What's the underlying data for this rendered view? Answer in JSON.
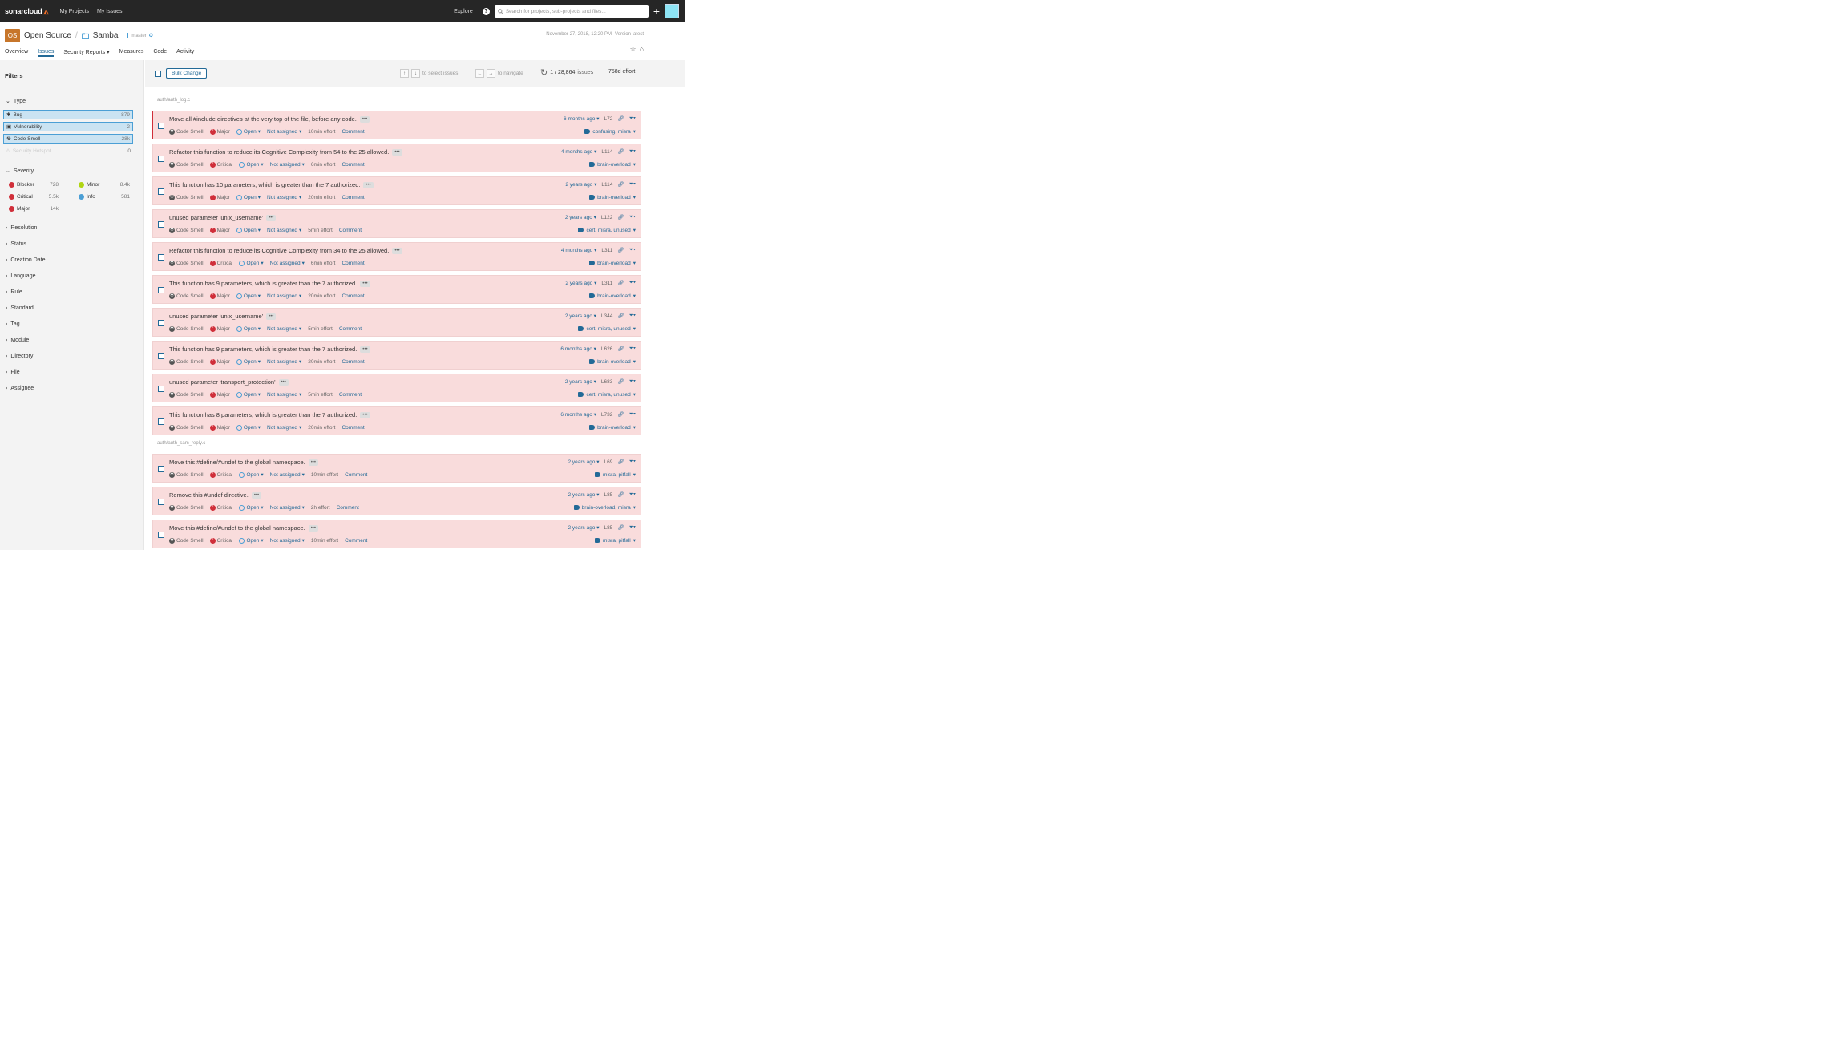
{
  "topbar": {
    "logo_text": "sonarcloud",
    "nav": [
      "My Projects",
      "My Issues"
    ],
    "explore": "Explore",
    "help": "?",
    "search_placeholder": "Search for projects, sub-projects and files...",
    "plus": "+"
  },
  "project": {
    "org_badge": "OS",
    "org": "Open Source",
    "separator": "/",
    "name": "Samba",
    "branch": "master",
    "date": "November 27, 2018, 12:20 PM",
    "version": "Version latest",
    "tabs": [
      "Overview",
      "Issues",
      "Security Reports ▾",
      "Measures",
      "Code",
      "Activity"
    ],
    "active_tab": "Issues"
  },
  "sidebar": {
    "filters_title": "Filters",
    "type_label": "Type",
    "types": [
      {
        "label": "Bug",
        "count": "879"
      },
      {
        "label": "Vulnerability",
        "count": "2"
      },
      {
        "label": "Code Smell",
        "count": "28k"
      },
      {
        "label": "Security Hotspot",
        "count": "0"
      }
    ],
    "severity_label": "Severity",
    "severities": [
      {
        "label": "Blocker",
        "count": "728"
      },
      {
        "label": "Minor",
        "count": "8.4k"
      },
      {
        "label": "Critical",
        "count": "5.5k"
      },
      {
        "label": "Info",
        "count": "581"
      },
      {
        "label": "Major",
        "count": "14k"
      }
    ],
    "facets": [
      "Resolution",
      "Status",
      "Creation Date",
      "Language",
      "Rule",
      "Standard",
      "Tag",
      "Module",
      "Directory",
      "File",
      "Assignee"
    ]
  },
  "toolbar": {
    "bulk_change": "Bulk Change",
    "up": "↑",
    "down": "↓",
    "select_hint": "to select issues",
    "left": "←",
    "right": "→",
    "navigate_hint": "to navigate",
    "count": "1 / 28,864",
    "count_suffix": "issues",
    "effort": "758d effort"
  },
  "components": [
    "auth/auth_log.c",
    "auth/auth_sam_reply.c"
  ],
  "issues": [
    {
      "msg": "Move all #include directives at the very top of the file, before any code.",
      "type": "Code Smell",
      "sev": "Major",
      "status": "Open",
      "assignee": "Not assigned",
      "effort": "10min effort",
      "comment": "Comment",
      "age": "6 months ago",
      "line": "L72",
      "tags": "confusing, misra"
    },
    {
      "msg": "Refactor this function to reduce its Cognitive Complexity from 54 to the 25 allowed.",
      "type": "Code Smell",
      "sev": "Critical",
      "status": "Open",
      "assignee": "Not assigned",
      "effort": "6min effort",
      "comment": "Comment",
      "age": "4 months ago",
      "line": "L114",
      "tags": "brain-overload"
    },
    {
      "msg": "This function has 10 parameters, which is greater than the 7 authorized.",
      "type": "Code Smell",
      "sev": "Major",
      "status": "Open",
      "assignee": "Not assigned",
      "effort": "20min effort",
      "comment": "Comment",
      "age": "2 years ago",
      "line": "L114",
      "tags": "brain-overload"
    },
    {
      "msg": "unused parameter 'unix_username'",
      "type": "Code Smell",
      "sev": "Major",
      "status": "Open",
      "assignee": "Not assigned",
      "effort": "5min effort",
      "comment": "Comment",
      "age": "2 years ago",
      "line": "L122",
      "tags": "cert, misra, unused"
    },
    {
      "msg": "Refactor this function to reduce its Cognitive Complexity from 34 to the 25 allowed.",
      "type": "Code Smell",
      "sev": "Critical",
      "status": "Open",
      "assignee": "Not assigned",
      "effort": "6min effort",
      "comment": "Comment",
      "age": "4 months ago",
      "line": "L311",
      "tags": "brain-overload"
    },
    {
      "msg": "This function has 9 parameters, which is greater than the 7 authorized.",
      "type": "Code Smell",
      "sev": "Major",
      "status": "Open",
      "assignee": "Not assigned",
      "effort": "20min effort",
      "comment": "Comment",
      "age": "2 years ago",
      "line": "L311",
      "tags": "brain-overload"
    },
    {
      "msg": "unused parameter 'unix_username'",
      "type": "Code Smell",
      "sev": "Major",
      "status": "Open",
      "assignee": "Not assigned",
      "effort": "5min effort",
      "comment": "Comment",
      "age": "2 years ago",
      "line": "L344",
      "tags": "cert, misra, unused"
    },
    {
      "msg": "This function has 9 parameters, which is greater than the 7 authorized.",
      "type": "Code Smell",
      "sev": "Major",
      "status": "Open",
      "assignee": "Not assigned",
      "effort": "20min effort",
      "comment": "Comment",
      "age": "6 months ago",
      "line": "L626",
      "tags": "brain-overload"
    },
    {
      "msg": "unused parameter 'transport_protection'",
      "type": "Code Smell",
      "sev": "Major",
      "status": "Open",
      "assignee": "Not assigned",
      "effort": "5min effort",
      "comment": "Comment",
      "age": "2 years ago",
      "line": "L683",
      "tags": "cert, misra, unused"
    },
    {
      "msg": "This function has 8 parameters, which is greater than the 7 authorized.",
      "type": "Code Smell",
      "sev": "Major",
      "status": "Open",
      "assignee": "Not assigned",
      "effort": "20min effort",
      "comment": "Comment",
      "age": "6 months ago",
      "line": "L732",
      "tags": "brain-overload"
    },
    {
      "msg": "Move this #define/#undef to the global namespace.",
      "type": "Code Smell",
      "sev": "Critical",
      "status": "Open",
      "assignee": "Not assigned",
      "effort": "10min effort",
      "comment": "Comment",
      "age": "2 years ago",
      "line": "L69",
      "tags": "misra, pitfall"
    },
    {
      "msg": "Remove this #undef directive.",
      "type": "Code Smell",
      "sev": "Critical",
      "status": "Open",
      "assignee": "Not assigned",
      "effort": "2h effort",
      "comment": "Comment",
      "age": "2 years ago",
      "line": "L85",
      "tags": "brain-overload, misra"
    },
    {
      "msg": "Move this #define/#undef to the global namespace.",
      "type": "Code Smell",
      "sev": "Critical",
      "status": "Open",
      "assignee": "Not assigned",
      "effort": "10min effort",
      "comment": "Comment",
      "age": "2 years ago",
      "line": "L85",
      "tags": "misra, pitfall"
    }
  ]
}
